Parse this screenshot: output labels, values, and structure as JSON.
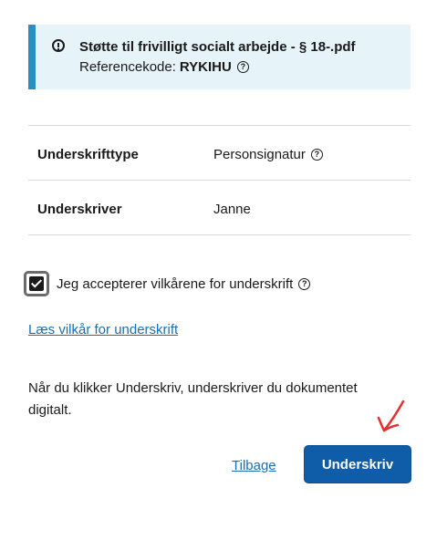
{
  "info": {
    "title": "Støtte til frivilligt socialt arbejde - § 18-.pdf",
    "reference_label": "Referencekode:",
    "reference_code": "RYKIHU"
  },
  "table": {
    "rows": [
      {
        "label": "Underskrifttype",
        "value": "Personsignatur",
        "has_help": true
      },
      {
        "label": "Underskriver",
        "value": "Janne",
        "has_help": false
      }
    ]
  },
  "accept": {
    "label": "Jeg accepterer vilkårene for underskrift",
    "checked": true
  },
  "terms_link": "Læs vilkår for underskrift",
  "notice": "Når du klikker Underskriv, underskriver du dokumentet digitalt.",
  "actions": {
    "back_label": "Tilbage",
    "sign_label": "Underskriv"
  },
  "colors": {
    "accent": "#0f5ca8",
    "info_bg": "#e6f3f8",
    "info_bar": "#2a8ec5",
    "link": "#1b6fae",
    "annotation": "#e0322f"
  }
}
